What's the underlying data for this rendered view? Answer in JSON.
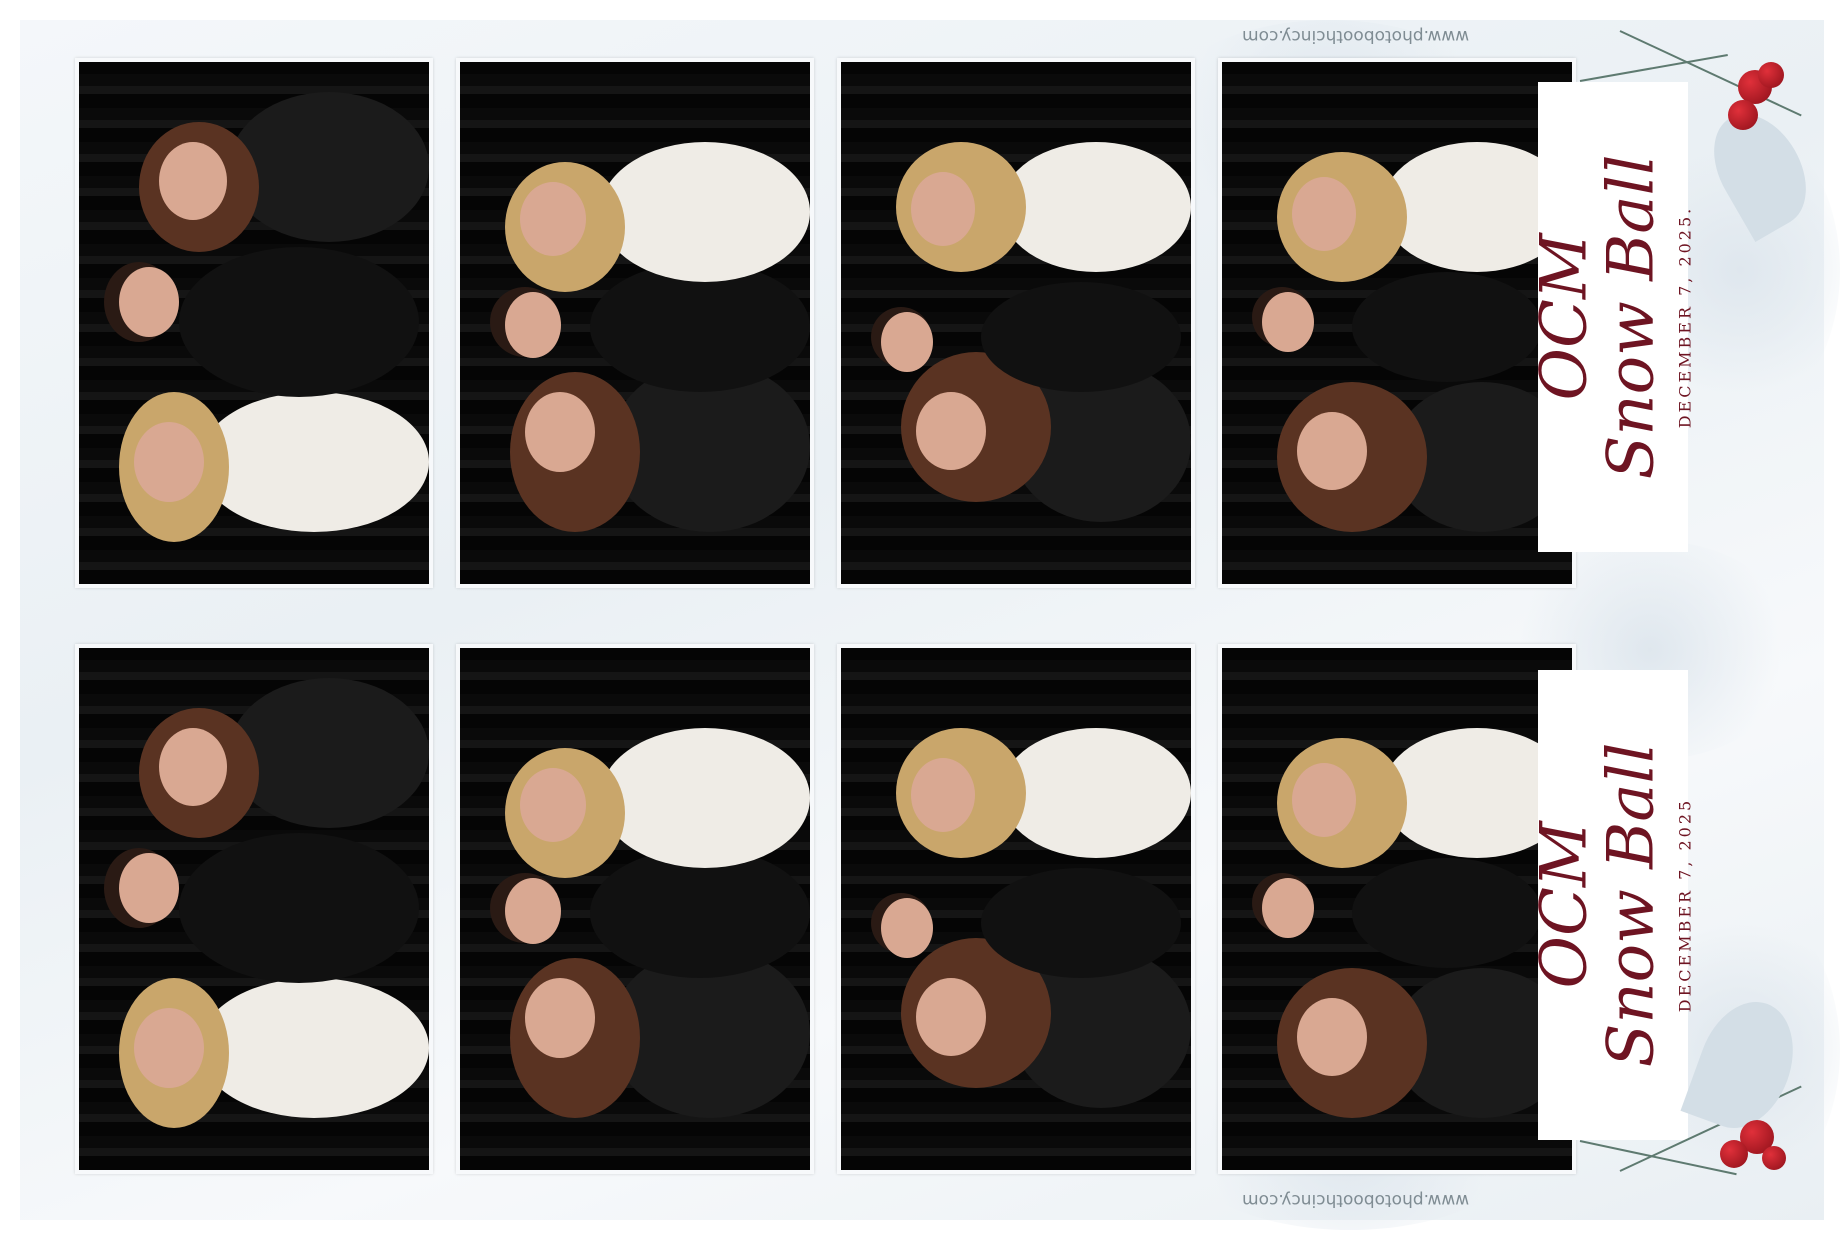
{
  "strips": [
    {
      "title_line1": "OCM",
      "title_line2": "Snow Ball",
      "date": "DECEMBER 7, 2025.",
      "website": "www.photoboothcincy.com",
      "photo_count": 4
    },
    {
      "title_line1": "OCM",
      "title_line2": "Snow Ball",
      "date": "DECEMBER 7, 2025",
      "website": "www.photoboothcincy.com",
      "photo_count": 4
    }
  ],
  "colors": {
    "title": "#6e1422",
    "backdrop": "#0b0b0b",
    "berry": "#c4212c"
  }
}
